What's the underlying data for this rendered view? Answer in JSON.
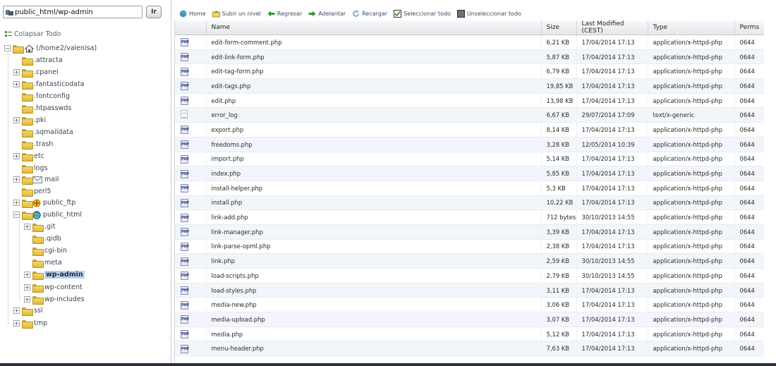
{
  "pathbar": {
    "path": "public_html/wp-admin",
    "go_label": "Ir"
  },
  "tree": {
    "collapse_label": "Colapsar Todo",
    "root_label": "(/home2/valenisa)",
    "items": [
      {
        "label": ".attracta"
      },
      {
        "label": ".cpanel"
      },
      {
        "label": ".fantasticodata"
      },
      {
        "label": ".fontconfig"
      },
      {
        "label": ".htpasswds"
      },
      {
        "label": ".pki"
      },
      {
        "label": ".sqmaildata"
      },
      {
        "label": ".trash"
      },
      {
        "label": "etc"
      },
      {
        "label": "logs"
      },
      {
        "label": "mail"
      },
      {
        "label": "perl5"
      },
      {
        "label": "public_ftp"
      },
      {
        "label": "public_html"
      },
      {
        "label": ".git"
      },
      {
        "label": ".qidb"
      },
      {
        "label": "cgi-bin"
      },
      {
        "label": "meta"
      },
      {
        "label": "wp-admin"
      },
      {
        "label": "wp-content"
      },
      {
        "label": "wp-includes"
      },
      {
        "label": "ssl"
      },
      {
        "label": "tmp"
      }
    ]
  },
  "toolbar": {
    "home": "Home",
    "up": "Subir un nivel",
    "back": "Regresar",
    "forward": "Adelantar",
    "reload": "Recargar",
    "select_all": "Seleccionar todo",
    "unselect_all": "Unseleccionar todo"
  },
  "table": {
    "headers": {
      "name": "Name",
      "size": "Size",
      "modified": "Last Modified (CEST)",
      "type": "Type",
      "perms": "Perms"
    },
    "rows": [
      {
        "icon": "php-file-icon",
        "name": "edit-form-comment.php",
        "size": "6,21 KB",
        "modified": "17/04/2014 17:13",
        "type": "application/x-httpd-php",
        "perms": "0644"
      },
      {
        "icon": "php-file-icon",
        "name": "edit-link-form.php",
        "size": "5,87 KB",
        "modified": "17/04/2014 17:13",
        "type": "application/x-httpd-php",
        "perms": "0644"
      },
      {
        "icon": "php-file-icon",
        "name": "edit-tag-form.php",
        "size": "6,79 KB",
        "modified": "17/04/2014 17:13",
        "type": "application/x-httpd-php",
        "perms": "0644"
      },
      {
        "icon": "php-file-icon",
        "name": "edit-tags.php",
        "size": "19,85 KB",
        "modified": "17/04/2014 17:13",
        "type": "application/x-httpd-php",
        "perms": "0644"
      },
      {
        "icon": "php-file-icon",
        "name": "edit.php",
        "size": "13,98 KB",
        "modified": "17/04/2014 17:13",
        "type": "application/x-httpd-php",
        "perms": "0644"
      },
      {
        "icon": "text-file-icon",
        "name": "error_log",
        "size": "6,67 KB",
        "modified": "29/07/2014 17:09",
        "type": "text/x-generic",
        "perms": "0644"
      },
      {
        "icon": "php-file-icon",
        "name": "export.php",
        "size": "8,14 KB",
        "modified": "17/04/2014 17:13",
        "type": "application/x-httpd-php",
        "perms": "0644"
      },
      {
        "icon": "php-file-icon",
        "name": "freedoms.php",
        "size": "3,28 KB",
        "modified": "12/05/2014 10:39",
        "type": "application/x-httpd-php",
        "perms": "0644"
      },
      {
        "icon": "php-file-icon",
        "name": "import.php",
        "size": "5,14 KB",
        "modified": "17/04/2014 17:13",
        "type": "application/x-httpd-php",
        "perms": "0644"
      },
      {
        "icon": "php-file-icon",
        "name": "index.php",
        "size": "5,85 KB",
        "modified": "17/04/2014 17:13",
        "type": "application/x-httpd-php",
        "perms": "0644"
      },
      {
        "icon": "php-file-icon",
        "name": "install-helper.php",
        "size": "5,3 KB",
        "modified": "17/04/2014 17:13",
        "type": "application/x-httpd-php",
        "perms": "0644"
      },
      {
        "icon": "php-file-icon",
        "name": "install.php",
        "size": "10,22 KB",
        "modified": "17/04/2014 17:13",
        "type": "application/x-httpd-php",
        "perms": "0644"
      },
      {
        "icon": "php-file-icon",
        "name": "link-add.php",
        "size": "712 bytes",
        "modified": "30/10/2013 14:55",
        "type": "application/x-httpd-php",
        "perms": "0644"
      },
      {
        "icon": "php-file-icon",
        "name": "link-manager.php",
        "size": "3,39 KB",
        "modified": "17/04/2014 17:13",
        "type": "application/x-httpd-php",
        "perms": "0644"
      },
      {
        "icon": "php-file-icon",
        "name": "link-parse-opml.php",
        "size": "2,38 KB",
        "modified": "17/04/2014 17:13",
        "type": "application/x-httpd-php",
        "perms": "0644"
      },
      {
        "icon": "php-file-icon",
        "name": "link.php",
        "size": "2,59 KB",
        "modified": "30/10/2013 14:55",
        "type": "application/x-httpd-php",
        "perms": "0644"
      },
      {
        "icon": "php-file-icon",
        "name": "load-scripts.php",
        "size": "2,79 KB",
        "modified": "30/10/2013 14:55",
        "type": "application/x-httpd-php",
        "perms": "0644"
      },
      {
        "icon": "php-file-icon",
        "name": "load-styles.php",
        "size": "3,11 KB",
        "modified": "17/04/2014 17:13",
        "type": "application/x-httpd-php",
        "perms": "0644"
      },
      {
        "icon": "php-file-icon",
        "name": "media-new.php",
        "size": "3,06 KB",
        "modified": "17/04/2014 17:13",
        "type": "application/x-httpd-php",
        "perms": "0644"
      },
      {
        "icon": "php-file-icon",
        "name": "media-upload.php",
        "size": "3,07 KB",
        "modified": "17/04/2014 17:13",
        "type": "application/x-httpd-php",
        "perms": "0644"
      },
      {
        "icon": "php-file-icon",
        "name": "media.php",
        "size": "5,12 KB",
        "modified": "17/04/2014 17:13",
        "type": "application/x-httpd-php",
        "perms": "0644"
      },
      {
        "icon": "php-file-icon",
        "name": "menu-header.php",
        "size": "7,63 KB",
        "modified": "17/04/2014 17:13",
        "type": "application/x-httpd-php",
        "perms": "0644"
      }
    ]
  },
  "colors": {
    "selection": "#b8d0f0",
    "row_alt": "#f2f6fb",
    "header_bg": "#e5e8ec"
  }
}
